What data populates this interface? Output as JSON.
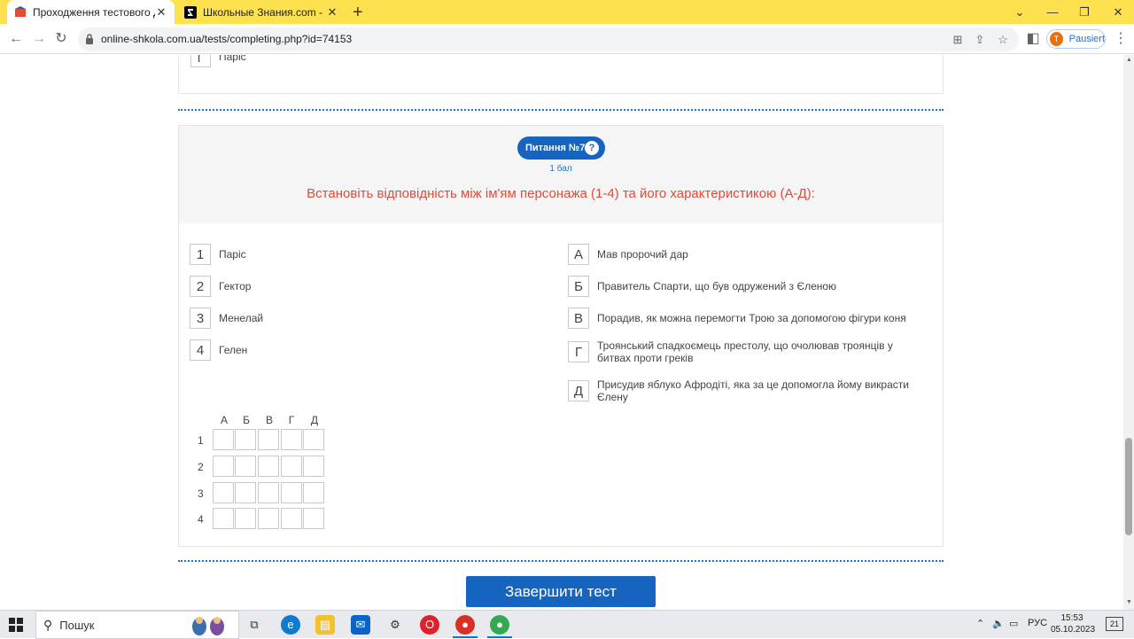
{
  "browser": {
    "tabs": [
      {
        "title": "Проходження тестового ДЗ - С",
        "active": true
      },
      {
        "title": "Школьные Знания.com - Реша",
        "active": false
      }
    ],
    "url": "online-shkola.com.ua/tests/completing.php?id=74153",
    "profile": {
      "initial": "T",
      "name": "Pausiert"
    }
  },
  "prev_question": {
    "number": "Г",
    "answer_text": "Паріс"
  },
  "question": {
    "badge": "Питання №7",
    "help": "?",
    "points": "1 бал",
    "text": "Встановіть відповідність між ім'ям персонажа (1-4) та його характеристикою (А-Д):",
    "left_items": [
      {
        "key": "1",
        "text": "Паріс"
      },
      {
        "key": "2",
        "text": "Гектор"
      },
      {
        "key": "3",
        "text": "Менелай"
      },
      {
        "key": "4",
        "text": "Гелен"
      }
    ],
    "right_items": [
      {
        "key": "А",
        "text": "Мав пророчий дар"
      },
      {
        "key": "Б",
        "text": "Правитель Спарти, що був одружений з Єленою"
      },
      {
        "key": "В",
        "text": "Порадив, як можна перемогти Трою за допомогою фігури коня"
      },
      {
        "key": "Г",
        "text": "Троянський спадкоємець престолу, що очолював троянців у битвах проти греків"
      },
      {
        "key": "Д",
        "text": "Присудив яблуко Афродіті, яка за це допомогла йому викрасти Єлену"
      }
    ],
    "grid_columns": [
      "А",
      "Б",
      "В",
      "Г",
      "Д"
    ],
    "grid_rows": [
      "1",
      "2",
      "3",
      "4"
    ]
  },
  "finish_button": "Завершити тест",
  "taskbar": {
    "search_placeholder": "Пошук",
    "language": "РУС",
    "time": "15:53",
    "date": "05.10.2023",
    "notifications": "21"
  },
  "colors": {
    "tab_strip": "#fde14f",
    "accent": "#1565c0",
    "question_text": "#e04b3a"
  }
}
